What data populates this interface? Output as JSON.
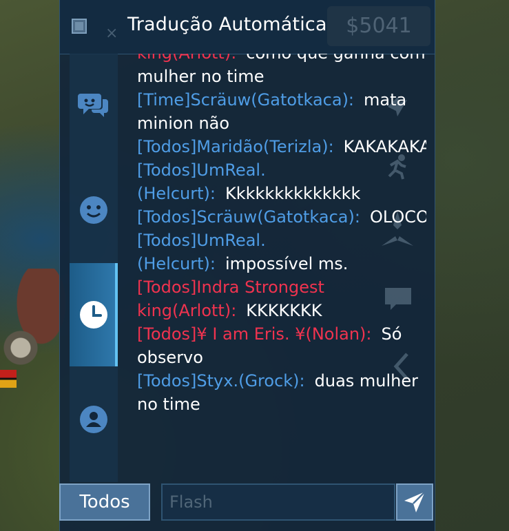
{
  "header": {
    "checkbox_checked": false,
    "title": "Tradução Automática",
    "gold_ghost": "$5041"
  },
  "tabs": [
    {
      "icon": "chat-bubbles-icon",
      "active": false
    },
    {
      "icon": "emoji-face-icon",
      "active": false
    },
    {
      "icon": "clock-icon",
      "active": true
    },
    {
      "icon": "friend-user-icon",
      "active": false
    }
  ],
  "messages": [
    {
      "color": "red",
      "sender": "king(Arlott):",
      "text": "como que ganha com mulher no time"
    },
    {
      "color": "blue",
      "sender": "[Time]Scräuw(Gatotkaca):",
      "text": "mata minion não"
    },
    {
      "color": "blue",
      "sender": "[Todos]Maridão(Terizla):",
      "text": "KAKAKAKAKSKKAKAKA"
    },
    {
      "color": "blue",
      "sender": "[Todos]UmReal.(Helcurt):",
      "text": "Kkkkkkkkkkkkkk"
    },
    {
      "color": "blue",
      "sender": "[Todos]Scräuw(Gatotkaca):",
      "text": "OLOCO"
    },
    {
      "color": "blue",
      "sender": "[Todos]UmReal.(Helcurt):",
      "text": "impossível ms."
    },
    {
      "color": "red",
      "sender": "[Todos]Indra Strongest king(Arlott):",
      "text": "KKKKKKK"
    },
    {
      "color": "red",
      "sender": "[Todos]¥ I am Eris. ¥(Nolan):",
      "text": "Só observo"
    },
    {
      "color": "blue",
      "sender": "[Todos]Styx.(Grock):",
      "text": "duas mulher no time"
    }
  ],
  "bottom": {
    "channel_label": "Todos",
    "input_value": "",
    "input_placeholder": "Flash"
  },
  "colors": {
    "panel_bg": "#12263a",
    "blue_sender": "#4f9de6",
    "red_sender": "#f0334f",
    "active_tab": "#2f79ad"
  }
}
